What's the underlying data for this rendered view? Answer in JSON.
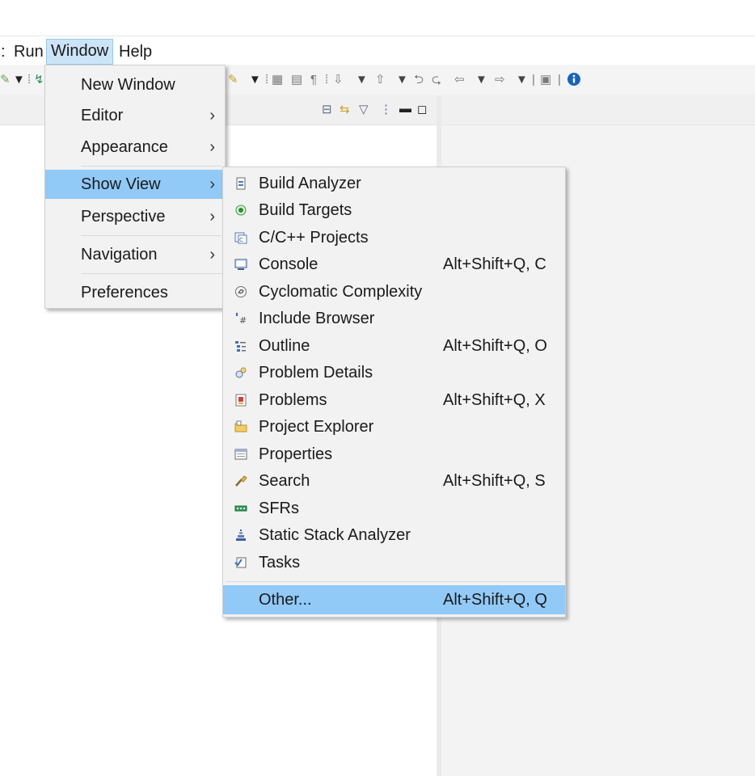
{
  "menubar": {
    "run": "Run",
    "window": "Window",
    "help": "Help"
  },
  "window_menu": {
    "items": [
      {
        "label": "New Window"
      },
      {
        "label": "Editor",
        "submenu": true
      },
      {
        "label": "Appearance",
        "submenu": true
      },
      {
        "label": "Show View",
        "submenu": true,
        "highlighted": true
      },
      {
        "label": "Perspective",
        "submenu": true
      },
      {
        "label": "Navigation",
        "submenu": true
      },
      {
        "label": "Preferences"
      }
    ],
    "arrow": "›"
  },
  "show_view_menu": {
    "items": [
      {
        "label": "Build Analyzer",
        "icon": "build-analyzer-icon",
        "shortcut": ""
      },
      {
        "label": "Build Targets",
        "icon": "build-targets-icon",
        "shortcut": ""
      },
      {
        "label": "C/C++ Projects",
        "icon": "cpp-projects-icon",
        "shortcut": ""
      },
      {
        "label": "Console",
        "icon": "console-icon",
        "shortcut": "Alt+Shift+Q, C"
      },
      {
        "label": "Cyclomatic Complexity",
        "icon": "cyclomatic-complexity-icon",
        "shortcut": ""
      },
      {
        "label": "Include Browser",
        "icon": "include-browser-icon",
        "shortcut": ""
      },
      {
        "label": "Outline",
        "icon": "outline-icon",
        "shortcut": "Alt+Shift+Q, O"
      },
      {
        "label": "Problem Details",
        "icon": "problem-details-icon",
        "shortcut": ""
      },
      {
        "label": "Problems",
        "icon": "problems-icon",
        "shortcut": "Alt+Shift+Q, X"
      },
      {
        "label": "Project Explorer",
        "icon": "project-explorer-icon",
        "shortcut": ""
      },
      {
        "label": "Properties",
        "icon": "properties-icon",
        "shortcut": ""
      },
      {
        "label": "Search",
        "icon": "search-icon",
        "shortcut": "Alt+Shift+Q, S"
      },
      {
        "label": "SFRs",
        "icon": "sfrs-icon",
        "shortcut": ""
      },
      {
        "label": "Static Stack Analyzer",
        "icon": "static-stack-analyzer-icon",
        "shortcut": ""
      },
      {
        "label": "Tasks",
        "icon": "tasks-icon",
        "shortcut": ""
      }
    ],
    "other": {
      "label": "Other...",
      "shortcut": "Alt+Shift+Q, Q"
    }
  },
  "colors": {
    "highlight": "#91c9f7",
    "menu_bg": "#f2f2f2",
    "active_menubar": "#cce4f7",
    "info_icon": "#1565c0"
  }
}
